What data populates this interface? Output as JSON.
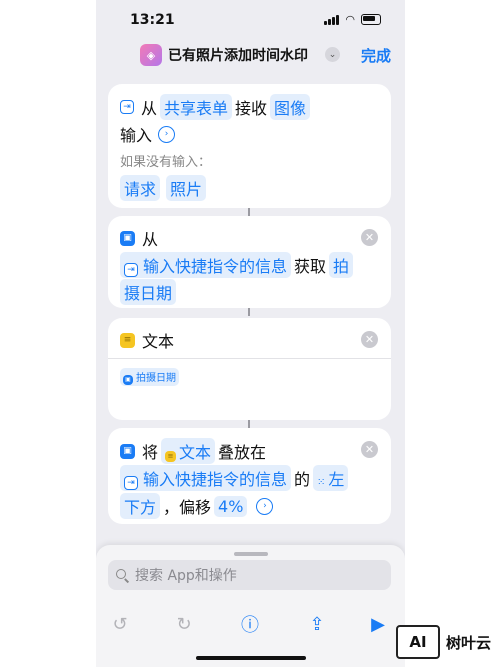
{
  "status": {
    "time": "13:21"
  },
  "nav": {
    "title": "已有照片添加时间水印",
    "done": "完成"
  },
  "card1": {
    "from": "从",
    "source": "共享表单",
    "receive": "接收",
    "type": "图像",
    "input": "输入",
    "if_no_input": "如果没有输入：",
    "opt1": "请求",
    "opt2": "照片"
  },
  "card2": {
    "from": "从",
    "input_info": "输入快捷指令的信息",
    "get": "获取",
    "field_part1": "拍",
    "field_part2": "摄日期"
  },
  "card3": {
    "title": "文本",
    "token": "拍摄日期"
  },
  "card4": {
    "will": "将",
    "text_token": "文本",
    "overlay": "叠放在",
    "input_info": "输入快捷指令的信息",
    "of": "的",
    "pos_part1": "左",
    "pos_part2": "下方",
    "offset": "，偏移",
    "percent": "4%"
  },
  "sheet": {
    "search_placeholder": "搜索 App和操作"
  },
  "watermark": {
    "logo": "AI",
    "text": "树叶云"
  },
  "colors": {
    "accent": "#1a7cf5",
    "token_bg": "#e3eefc"
  }
}
